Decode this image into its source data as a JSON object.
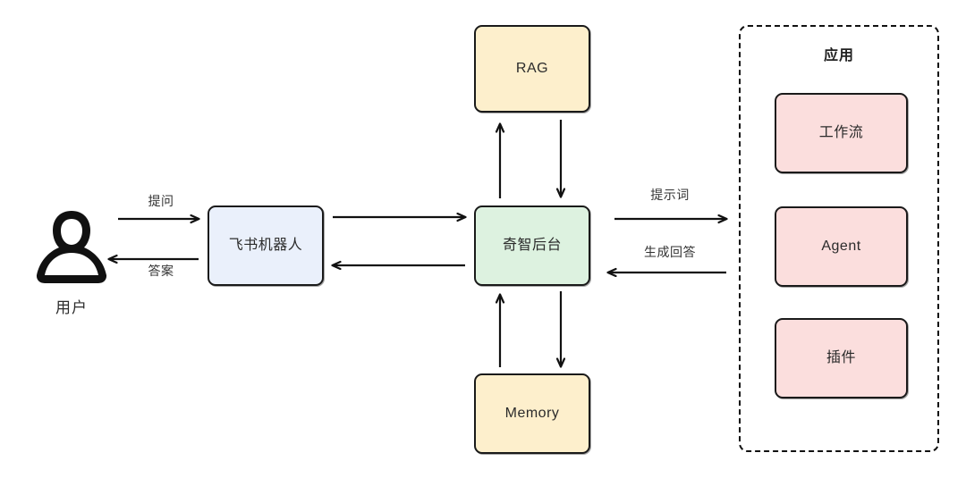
{
  "diagram": {
    "title": "",
    "colors": {
      "blue_fill": "#eaf0fb",
      "green_fill": "#ddf2e0",
      "yellow_fill": "#fdefcc",
      "pink_fill": "#fbdedd",
      "stroke": "#1a1a1a",
      "background": "#ffffff"
    },
    "actor": {
      "icon": "user-person-icon",
      "label": "用户"
    },
    "nodes": {
      "feishu_bot": "飞书机器人",
      "core": "奇智后台",
      "rag": "RAG",
      "memory": "Memory"
    },
    "app_group": {
      "title": "应用",
      "items": [
        {
          "label": "工作流"
        },
        {
          "label": "Agent"
        },
        {
          "label": "插件"
        }
      ]
    },
    "edges": {
      "ask": "提问",
      "answer": "答案",
      "prompt": "提示词",
      "generated_answer": "生成回答",
      "bot_to_core": "",
      "core_to_bot": "",
      "core_to_rag": "",
      "rag_to_core": "",
      "core_to_memory": "",
      "memory_to_core": ""
    }
  }
}
